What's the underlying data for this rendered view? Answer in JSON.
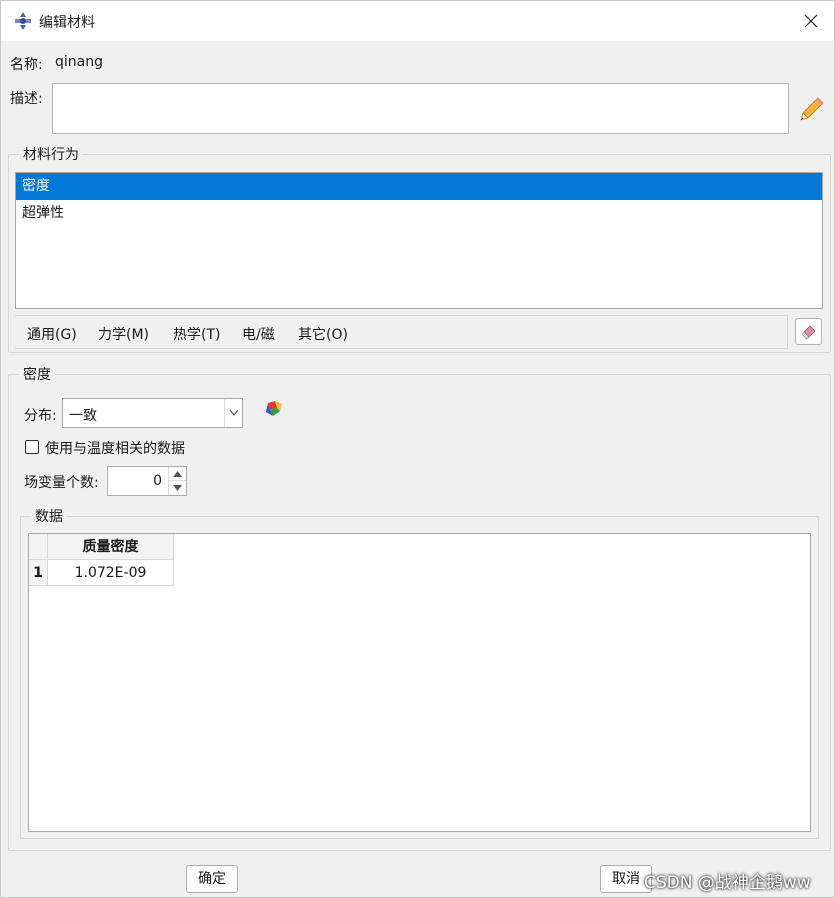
{
  "window": {
    "title": "编辑材料",
    "icon": "abaqus-material-icon",
    "close": "close-icon"
  },
  "fields": {
    "name_label": "名称:",
    "name_value": "qinang",
    "desc_label": "描述:",
    "desc_value": "",
    "edit_icon": "pencil-icon"
  },
  "behavior": {
    "legend": "材料行为",
    "items": [
      {
        "label": "密度",
        "selected": true
      },
      {
        "label": "超弹性",
        "selected": false
      }
    ],
    "menu": [
      "通用(G)",
      "力学(M)",
      "热学(T)",
      "电/磁",
      "其它(O)"
    ],
    "delete_icon": "eraser-icon"
  },
  "density": {
    "legend": "密度",
    "distribution_label": "分布:",
    "distribution_value": "一致",
    "distribution_icon": "distribution-icon",
    "temp_checkbox_label": "使用与温度相关的数据",
    "temp_checkbox_checked": false,
    "field_vars_label": "场变量个数:",
    "field_vars_value": "0"
  },
  "data": {
    "legend": "数据",
    "columns": [
      "质量密度"
    ],
    "rows": [
      {
        "index": "1",
        "values": [
          "1.072E-09"
        ]
      }
    ]
  },
  "buttons": {
    "ok": "确定",
    "cancel": "取消"
  },
  "watermark": "CSDN @战神企鹅ww",
  "colors": {
    "selection": "#0078d7",
    "dialog_bg": "#f0f0f0"
  }
}
